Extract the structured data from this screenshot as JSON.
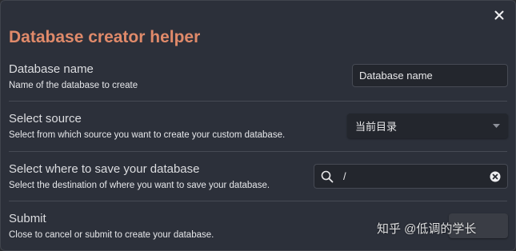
{
  "dialog": {
    "title": "Database creator helper",
    "close_icon": "close-icon"
  },
  "rows": {
    "database_name": {
      "label": "Database name",
      "description": "Name of the database to create",
      "input_value": "Database name"
    },
    "select_source": {
      "label": "Select source",
      "description": "Select from which source you want to create your custom database.",
      "selected_value": "当前目录",
      "dropdown_icon": "caret-down-icon"
    },
    "save_location": {
      "label": "Select where to save your database",
      "description": "Select the destination of where you want to save your database.",
      "path_value": "/",
      "search_icon": "search-icon",
      "clear_icon": "clear-icon"
    },
    "submit": {
      "label": "Submit",
      "description": "Close to cancel or submit to create your database.",
      "button_label": ""
    }
  },
  "watermark": "知乎 @低调的学长",
  "colors": {
    "title": "#e08a6a",
    "background": "#2c303a"
  }
}
